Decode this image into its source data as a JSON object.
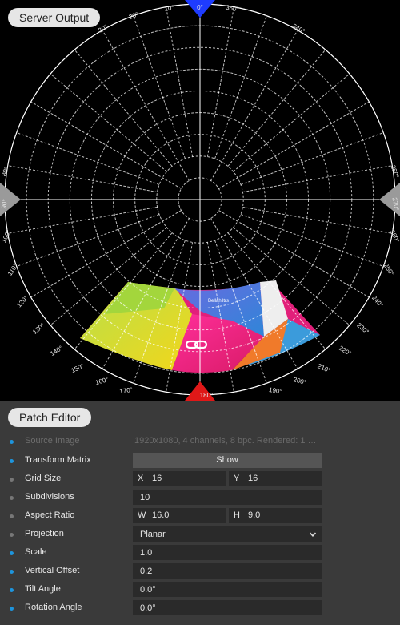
{
  "server_output": {
    "title": "Server Output",
    "content_label": "Bellahiltrs",
    "ticks_top": [
      "10°",
      "20°",
      "30°",
      "340°",
      "350°",
      "0°"
    ],
    "ticks_left": [
      "90°",
      "80°",
      "100°",
      "110°",
      "120°",
      "130°",
      "140°",
      "150°",
      "160°",
      "170°"
    ],
    "ticks_right": [
      "270°",
      "280°",
      "260°",
      "250°",
      "240°",
      "230°",
      "220°",
      "210°",
      "200°",
      "190°"
    ],
    "tick_bottom": "180°"
  },
  "patch_editor": {
    "title": "Patch Editor",
    "rows": [
      {
        "label": "Source Image",
        "value": "1920x1080, 4 channels, 8 bpc. Rendered: 1 ti..."
      },
      {
        "label": "Transform Matrix",
        "value": "Show"
      },
      {
        "label": "Grid Size",
        "x_label": "X",
        "x_value": "16",
        "y_label": "Y",
        "y_value": "16"
      },
      {
        "label": "Subdivisions",
        "value": "10"
      },
      {
        "label": "Aspect Ratio",
        "w_label": "W",
        "w_value": "16.0",
        "h_label": "H",
        "h_value": "9.0"
      },
      {
        "label": "Projection",
        "value": "Planar"
      },
      {
        "label": "Scale",
        "value": "1.0"
      },
      {
        "label": "Vertical Offset",
        "value": "0.2"
      },
      {
        "label": "Tilt Angle",
        "value": "0.0°"
      },
      {
        "label": "Rotation Angle",
        "value": "0.0°"
      }
    ]
  },
  "colors": {
    "marker_top": "#1e3cff",
    "marker_bottom": "#e01818",
    "accent_dot": "#1e95dd"
  },
  "icons": [
    "chain-link-icon",
    "chevron-down-icon"
  ]
}
